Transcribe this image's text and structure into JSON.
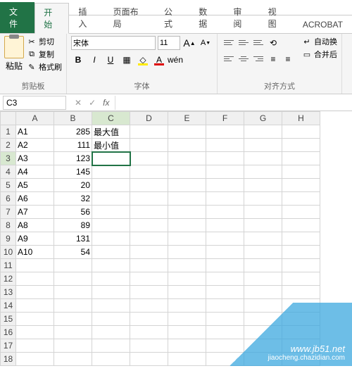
{
  "chart_data": {
    "type": "table",
    "title": "",
    "columns": [
      "",
      "A",
      "B",
      "C",
      "D",
      "E",
      "F",
      "G",
      "H"
    ],
    "rows": [
      [
        "1",
        "A1",
        285,
        "最大值",
        "",
        "",
        "",
        "",
        ""
      ],
      [
        "2",
        "A2",
        111,
        "最小值",
        "",
        "",
        "",
        "",
        ""
      ],
      [
        "3",
        "A3",
        123,
        "",
        "",
        "",
        "",
        "",
        ""
      ],
      [
        "4",
        "A4",
        145,
        "",
        "",
        "",
        "",
        "",
        ""
      ],
      [
        "5",
        "A5",
        20,
        "",
        "",
        "",
        "",
        "",
        ""
      ],
      [
        "6",
        "A6",
        32,
        "",
        "",
        "",
        "",
        "",
        ""
      ],
      [
        "7",
        "A7",
        56,
        "",
        "",
        "",
        "",
        "",
        ""
      ],
      [
        "8",
        "A8",
        89,
        "",
        "",
        "",
        "",
        "",
        ""
      ],
      [
        "9",
        "A9",
        131,
        "",
        "",
        "",
        "",
        "",
        ""
      ],
      [
        "10",
        "A10",
        54,
        "",
        "",
        "",
        "",
        "",
        ""
      ]
    ]
  },
  "qat": {
    "save": "💾",
    "undo": "↶",
    "redo": "↷"
  },
  "tabs": {
    "file": "文件",
    "home": "开始",
    "insert": "插入",
    "layout": "页面布局",
    "formulas": "公式",
    "data": "数据",
    "review": "审阅",
    "view": "视图",
    "acrobat": "ACROBAT"
  },
  "ribbon": {
    "clipboard": {
      "paste": "粘贴",
      "cut": "剪切",
      "copy": "复制",
      "painter": "格式刷",
      "label": "剪贴板"
    },
    "font": {
      "name": "宋体",
      "size": "11",
      "bold": "B",
      "italic": "I",
      "underline": "U",
      "grow": "A",
      "shrink": "A",
      "label": "字体"
    },
    "align": {
      "wrap": "自动换",
      "merge": "合并后",
      "label": "对齐方式"
    }
  },
  "namebox": "C3",
  "formula": "",
  "cols": [
    "A",
    "B",
    "C",
    "D",
    "E",
    "F",
    "G",
    "H"
  ],
  "rows": [
    {
      "n": "1",
      "a": "A1",
      "b": "285",
      "c": "最大值"
    },
    {
      "n": "2",
      "a": "A2",
      "b": "111",
      "c": "最小值"
    },
    {
      "n": "3",
      "a": "A3",
      "b": "123",
      "c": ""
    },
    {
      "n": "4",
      "a": "A4",
      "b": "145",
      "c": ""
    },
    {
      "n": "5",
      "a": "A5",
      "b": "20",
      "c": ""
    },
    {
      "n": "6",
      "a": "A6",
      "b": "32",
      "c": ""
    },
    {
      "n": "7",
      "a": "A7",
      "b": "56",
      "c": ""
    },
    {
      "n": "8",
      "a": "A8",
      "b": "89",
      "c": ""
    },
    {
      "n": "9",
      "a": "A9",
      "b": "131",
      "c": ""
    },
    {
      "n": "10",
      "a": "A10",
      "b": "54",
      "c": ""
    },
    {
      "n": "11"
    },
    {
      "n": "12"
    },
    {
      "n": "13"
    },
    {
      "n": "14"
    },
    {
      "n": "15"
    },
    {
      "n": "16"
    },
    {
      "n": "17"
    },
    {
      "n": "18"
    }
  ],
  "selected": {
    "row": "3",
    "col": "C"
  },
  "watermark": {
    "line1": "www.jb51.net",
    "line2": "jiaocheng.chazidian.com"
  }
}
